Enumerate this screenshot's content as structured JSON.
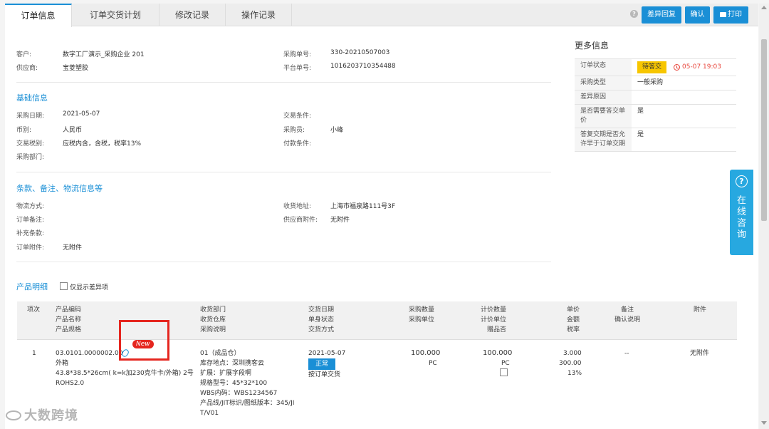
{
  "tabs": [
    "订单信息",
    "订单交货计划",
    "修改记录",
    "操作记录"
  ],
  "toolbar": {
    "help": "?",
    "diff_reply": "差异回复",
    "confirm": "确认",
    "print": "打印"
  },
  "header": {
    "customer_label": "客户:",
    "customer": "数字工厂演示_采购企业 201",
    "supplier_label": "供应商:",
    "supplier": "宝菱塑胶",
    "po_label": "采购单号:",
    "po": "330-20210507003",
    "platform_label": "平台单号:",
    "platform": "1016203710354488"
  },
  "basic": {
    "title": "基础信息",
    "purchase_date_label": "采购日期:",
    "purchase_date": "2021-05-07",
    "currency_label": "币别:",
    "currency": "人民币",
    "tax_label": "交易税别:",
    "tax": "应税内含，含税，税率13%",
    "dept_label": "采购部门:",
    "trade_terms_label": "交易条件:",
    "buyer_label": "采购员:",
    "buyer": "小峰",
    "payment_label": "付款条件:"
  },
  "terms": {
    "title": "条款、备注、物流信息等",
    "logistics_label": "物流方式:",
    "remark_label": "订单备注:",
    "extra_label": "补充条款:",
    "attach_label": "订单附件:",
    "attach": "无附件",
    "address_label": "收货地址:",
    "address": "上海市福泉路111号3F",
    "supplier_attach_label": "供应商附件:",
    "supplier_attach": "无附件"
  },
  "more": {
    "title": "更多信息",
    "rows": [
      {
        "k": "订单状态",
        "badge": "待答交",
        "time": "05-07 19:03"
      },
      {
        "k": "采购类型",
        "v": "一般采购"
      },
      {
        "k": "差异原因",
        "v": ""
      },
      {
        "k": "是否需要答交单价",
        "v": "是"
      },
      {
        "k": "答复交期是否允许早于订单交期",
        "v": "是"
      }
    ]
  },
  "products": {
    "title": "产品明细",
    "only_diff": "仅显示差异项",
    "headers": {
      "idx": "项次",
      "code": "产品编码",
      "name": "产品名称",
      "spec": "产品规格",
      "dept": "收货部门",
      "wh": "收货仓库",
      "desc": "采购说明",
      "date": "交货日期",
      "status": "单身状态",
      "method": "交货方式",
      "qty": "采购数量",
      "unit": "采购单位",
      "pqty": "计价数量",
      "punit": "计价单位",
      "gift": "赠品否",
      "price": "单价",
      "amount": "金额",
      "rate": "税率",
      "note": "备注",
      "confirm": "确认说明",
      "attach": "附件"
    },
    "row": {
      "idx": "1",
      "code": "03.0101.0000002.00",
      "name": "外箱",
      "spec": "43.8*38.5*26cm( k=k加230克牛卡/外箱) 2号",
      "rohs": "ROHS2.0",
      "new": "New",
      "dept": "01（成品仓）",
      "loc": "库存地点：深圳携客云",
      "ext": "扩展：扩展字段啊",
      "model": "规格型号：45*32*100",
      "wbs": "WBS内码：WBS1234567",
      "line1": "产品线/JIT标识/图纸版本：345/JI",
      "line2": "T/V01",
      "date": "2021-05-07",
      "status": "正常",
      "method": "按订单交货",
      "qty": "100.000",
      "unit": "PC",
      "pqty": "100.000",
      "punit": "PC",
      "price": "3.000",
      "amount": "300.00",
      "rate": "13%",
      "note": "--",
      "attach": "无附件"
    }
  },
  "consult": {
    "q": "?",
    "text": "在线咨询"
  },
  "watermark": "大数跨境"
}
